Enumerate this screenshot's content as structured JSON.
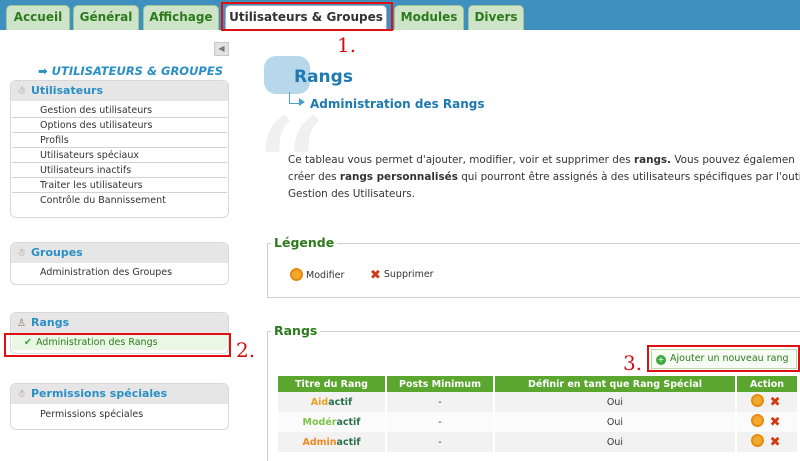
{
  "tabs": [
    {
      "label": "Accueil"
    },
    {
      "label": "Général"
    },
    {
      "label": "Affichage"
    },
    {
      "label": "Utilisateurs & Groupes"
    },
    {
      "label": "Modules"
    },
    {
      "label": "Divers"
    }
  ],
  "annotations": {
    "n1": "1.",
    "n2": "2.",
    "n3": "3."
  },
  "sidebar": {
    "collapse_glyph": "◀",
    "heading": "➡ UTILISATEURS & GROUPES",
    "utilisateurs": {
      "title": "Utilisateurs",
      "items": [
        "Gestion des utilisateurs",
        "Options des utilisateurs",
        "Profils",
        "Utilisateurs spéciaux",
        "Utilisateurs inactifs",
        "Traiter les utilisateurs",
        "Contrôle du Bannissement"
      ]
    },
    "groupes": {
      "title": "Groupes",
      "items": [
        "Administration des Groupes"
      ]
    },
    "rangs": {
      "title": "Rangs",
      "items": [
        "Administration des Rangs"
      ]
    },
    "permissions": {
      "title": "Permissions spéciales",
      "items": [
        "Permissions spéciales"
      ]
    }
  },
  "main": {
    "title": "Rangs",
    "subtitle": "Administration des Rangs",
    "desc": {
      "l1a": "Ce tableau vous permet d'ajouter, modifier, voir et supprimer des ",
      "l1b": "rangs.",
      "l1c": " Vous pouvez égalemen",
      "l2a": "créer des ",
      "l2b": "rangs personnalisés",
      "l2c": " qui pourront être assignés à des utilisateurs spécifiques par l'outi",
      "l3": "Gestion des Utilisateurs."
    },
    "legend": {
      "title": "Légende",
      "edit": "Modifier",
      "delete": "Supprimer"
    },
    "ranks": {
      "title": "Rangs",
      "add_button": "Ajouter un nouveau rang",
      "columns": [
        "Titre du Rang",
        "Posts Minimum",
        "Définir en tant que Rang Spécial",
        "Action"
      ],
      "rows": [
        {
          "prefix": "Aid",
          "suffix": "actif",
          "prefix_color": "#f0a020",
          "posts": "-",
          "special": "Oui"
        },
        {
          "prefix": "Modér",
          "suffix": "actif",
          "prefix_color": "#7dc24a",
          "posts": "-",
          "special": "Oui"
        },
        {
          "prefix": "Admin",
          "suffix": "actif",
          "prefix_color": "#f08a20",
          "posts": "-",
          "special": "Oui"
        }
      ]
    }
  }
}
